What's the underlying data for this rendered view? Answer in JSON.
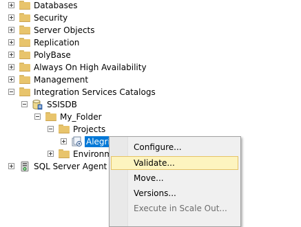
{
  "tree": {
    "databases": "Databases",
    "security": "Security",
    "server_objects": "Server Objects",
    "replication": "Replication",
    "polybase": "PolyBase",
    "always_on": "Always On High Availability",
    "management": "Management",
    "integration_services_catalogs": "Integration Services Catalogs",
    "ssisdb": "SSISDB",
    "my_folder": "My_Folder",
    "projects": "Projects",
    "selected_project": "Alegri...",
    "environments": "Environm...",
    "sql_server_agent": "SQL Server Agent"
  },
  "context_menu": {
    "items": [
      {
        "label": "Configure...",
        "enabled": true
      },
      {
        "label": "Validate...",
        "enabled": true,
        "highlighted": true
      },
      {
        "label": "Move...",
        "enabled": true
      },
      {
        "label": "Versions...",
        "enabled": true
      },
      {
        "label": "Execute in Scale Out...",
        "enabled": false
      }
    ]
  },
  "colors": {
    "selection": "#0078d7",
    "menu_hover": "#fdf4bf",
    "menu_hover_border": "#e5c365",
    "folder": "#e8c46c"
  }
}
